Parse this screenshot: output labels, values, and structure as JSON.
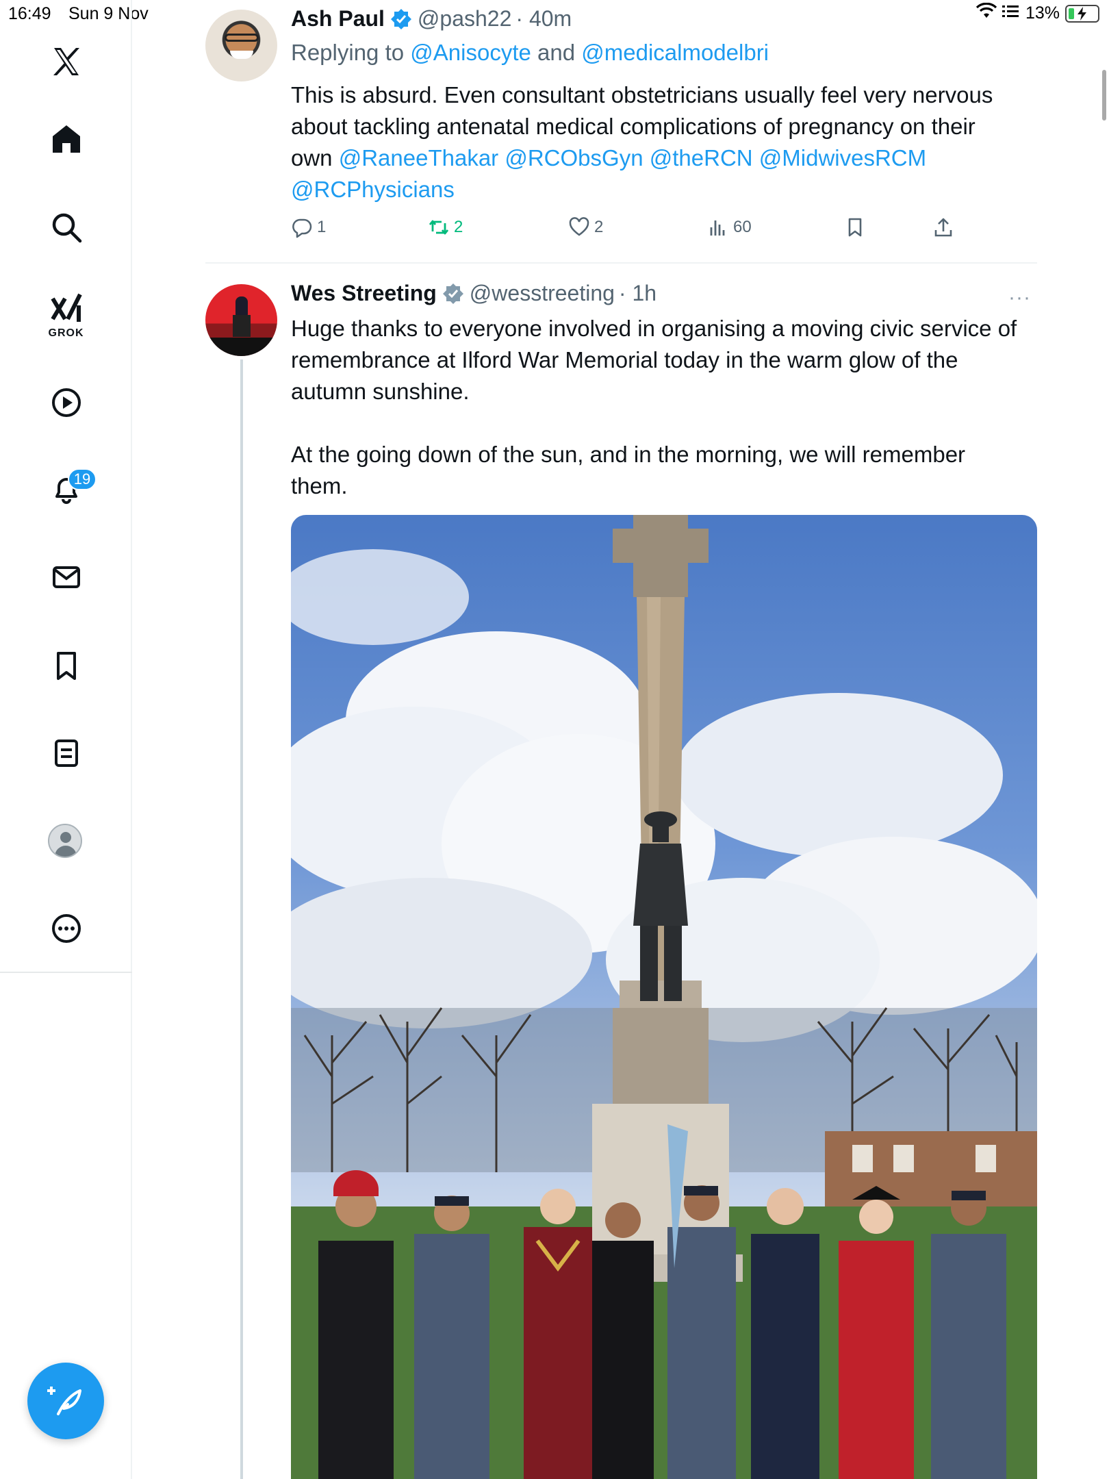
{
  "status_bar": {
    "time": "16:49",
    "date": "Sun 9 Nov",
    "battery": "13%"
  },
  "sidebar": {
    "grok_label": "GROK",
    "notifications_badge": "19",
    "icons": [
      "x-logo-icon",
      "home-icon",
      "search-icon",
      "grok-icon",
      "video-icon",
      "notifications-icon",
      "messages-icon",
      "bookmarks-icon",
      "lists-icon",
      "profile-icon",
      "more-icon"
    ]
  },
  "colors": {
    "accent": "#1d9bf0",
    "retweet_green": "#00ba7c",
    "muted_text": "#536471"
  },
  "tweets": [
    {
      "name": "Ash Paul",
      "handle": "@pash22",
      "time": "· 40m",
      "reply_prefix": "Replying to ",
      "reply_user1": "@Anisocyte",
      "reply_and": " and ",
      "reply_user2": "@medicalmodelbri",
      "text_line1": "This is absurd. Even consultant obstetricians usually feel very nervous",
      "text_line2": "about tackling antenatal medical complications of pregnancy on their",
      "text_line3_prefix": "own ",
      "mention1": "@RaneeThakar",
      "mention2": "@RCObsGyn",
      "mention3": "@theRCN",
      "mention4": "@MidwivesRCM",
      "mention5": "@RCPhysicians",
      "replies": "1",
      "retweets": "2",
      "likes": "2",
      "views": "60"
    },
    {
      "name": "Wes Streeting",
      "handle": "@wesstreeting",
      "time": "· 1h",
      "more": "···",
      "text_line1": "Huge thanks to everyone involved in organising a moving civic service of",
      "text_line2": "remembrance at Ilford War Memorial today in the warm glow of the",
      "text_line3": "autumn sunshine.",
      "text_line4": "At the going down of the sun, and in the morning, we will remember",
      "text_line5": "them."
    }
  ]
}
